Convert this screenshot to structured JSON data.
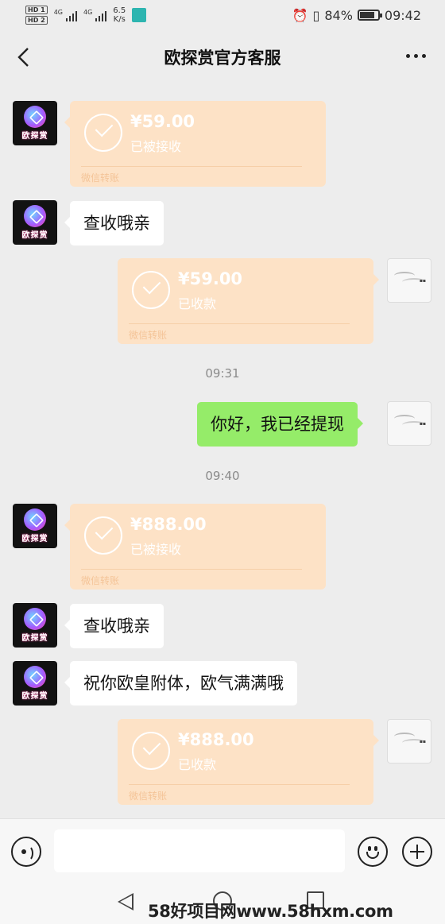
{
  "status_bar": {
    "hd1": "HD 1",
    "hd2": "HD 2",
    "signal1_label": "4G",
    "signal2_label": "4G",
    "speed": "6.5",
    "speed_unit": "K/s",
    "battery": "84%",
    "battery_level": 0.84,
    "time": "09:42"
  },
  "header": {
    "title": "欧探赏官方客服"
  },
  "avatar_text": "欧探赏",
  "messages": [
    {
      "type": "transfer",
      "side": "left",
      "amount": "¥59.00",
      "status": "已被接收",
      "footer": "微信转账"
    },
    {
      "type": "text",
      "side": "left",
      "text": "查收哦亲"
    },
    {
      "type": "transfer",
      "side": "right",
      "amount": "¥59.00",
      "status": "已收款",
      "footer": "微信转账"
    },
    {
      "type": "time",
      "text": "09:31"
    },
    {
      "type": "text",
      "side": "right",
      "text": "你好，我已经提现"
    },
    {
      "type": "time",
      "text": "09:40"
    },
    {
      "type": "transfer",
      "side": "left",
      "amount": "¥888.00",
      "status": "已被接收",
      "footer": "微信转账"
    },
    {
      "type": "text",
      "side": "left",
      "text": "查收哦亲"
    },
    {
      "type": "text",
      "side": "left",
      "text": "祝你欧皇附体，欧气满满哦"
    },
    {
      "type": "transfer",
      "side": "right",
      "amount": "¥888.00",
      "status": "已收款",
      "footer": "微信转账"
    }
  ],
  "input": {
    "value": "",
    "placeholder": ""
  },
  "watermark": "58好项目网www.58hxm.com",
  "colors": {
    "background": "#ededed",
    "transfer_bg": "#fde2c6",
    "self_bubble": "#95ec69",
    "other_bubble": "#ffffff"
  }
}
